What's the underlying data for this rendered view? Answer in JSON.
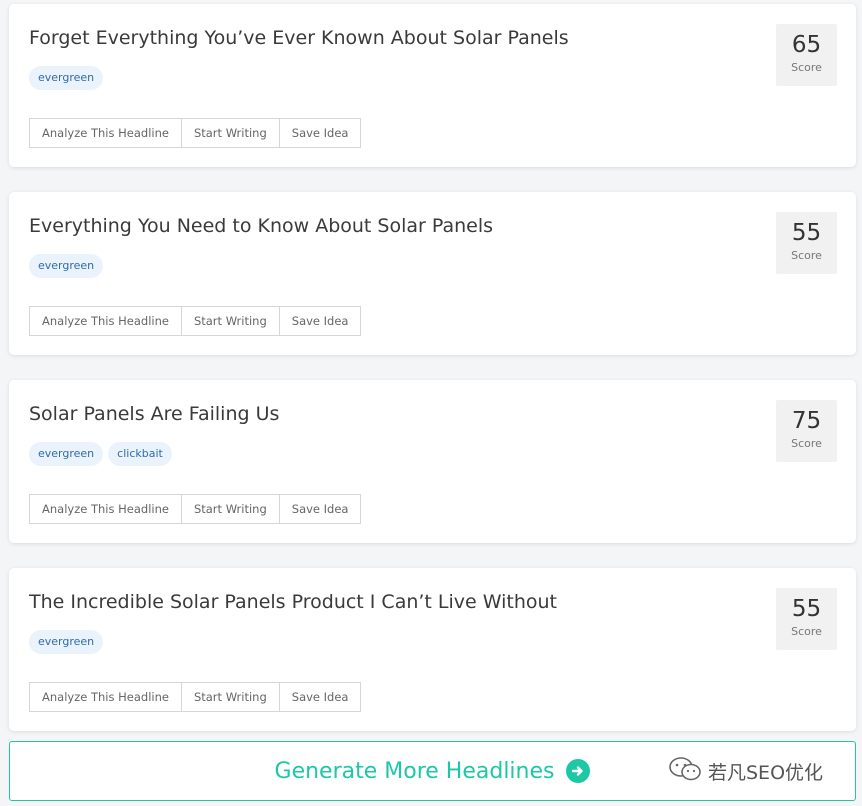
{
  "cards": [
    {
      "headline": "Forget Everything You’ve Ever Known About Solar Panels",
      "tags": [
        "evergreen"
      ],
      "score": "65"
    },
    {
      "headline": "Everything You Need to Know About Solar Panels",
      "tags": [
        "evergreen"
      ],
      "score": "55"
    },
    {
      "headline": "Solar Panels Are Failing Us",
      "tags": [
        "evergreen",
        "clickbait"
      ],
      "score": "75"
    },
    {
      "headline": "The Incredible Solar Panels Product I Can’t Live Without",
      "tags": [
        "evergreen"
      ],
      "score": "55"
    }
  ],
  "actions": {
    "analyze": "Analyze This Headline",
    "start": "Start Writing",
    "save": "Save Idea"
  },
  "score_label": "Score",
  "generate_label": "Generate More Headlines",
  "watermark": "若凡SEO优化",
  "colors": {
    "accent": "#1dc8a6",
    "tag_bg": "#eaf2fb",
    "tag_text": "#2f6da8"
  },
  "icons": {
    "generate": "arrow-right-circle-icon",
    "watermark": "wechat-icon"
  }
}
